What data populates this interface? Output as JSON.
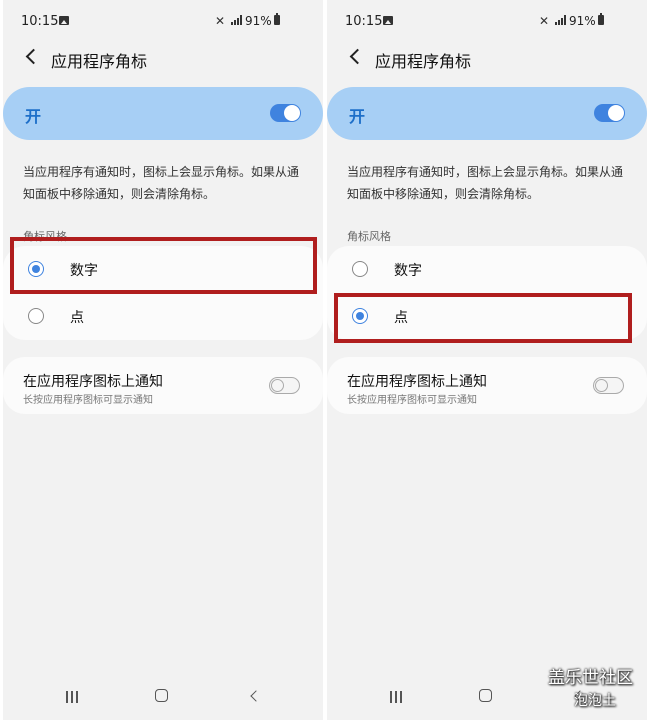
{
  "status_bar": {
    "time": "10:15",
    "battery": "91%",
    "mute_glyph": "✕"
  },
  "header": {
    "title": "应用程序角标"
  },
  "master_switch": {
    "label": "开",
    "state": "on"
  },
  "description": "当应用程序有通知时，图标上会显示角标。如果从通知面板中移除通知，则会清除角标。",
  "badge_style": {
    "section_label": "角标风格",
    "options": [
      {
        "label": "数字"
      },
      {
        "label": "点"
      }
    ]
  },
  "app_icon_notifications": {
    "title": "在应用程序图标上通知",
    "subtitle": "长按应用程序图标可显示通知",
    "state": "off"
  },
  "screens": [
    {
      "selected_option": "数字"
    },
    {
      "selected_option": "点"
    }
  ],
  "colors": {
    "accent": "#3f83df",
    "master_bg": "#a7cff5",
    "highlight": "#b01e1e"
  },
  "watermark": {
    "line1": "盖乐世社区",
    "line2": "泡泡土"
  }
}
